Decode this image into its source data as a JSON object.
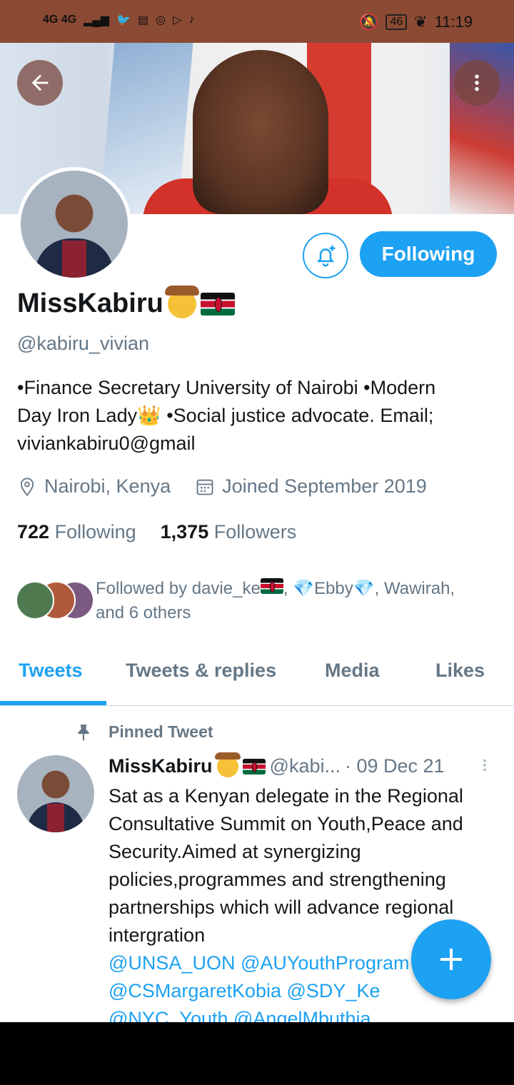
{
  "status_bar": {
    "network_left": "4G 4G",
    "battery": "46",
    "time": "11:19"
  },
  "profile": {
    "name": "MissKabiru",
    "handle": "@kabiru_vivian",
    "bio_line1": "•Finance Secretary University of Nairobi •Modern",
    "bio_line2a": "Day Iron Lady",
    "bio_line2b": " •Social justice advocate. Email;",
    "bio_line3": "viviankabiru0@gmail",
    "location": "Nairobi, Kenya",
    "joined": "Joined September 2019",
    "following_count": "722",
    "following_label": "Following",
    "followers_count": "1,375",
    "followers_label": "Followers",
    "followed_by_a": "Followed by davie_ke",
    "followed_by_b": ", 💎Ebby💎, Wawirah,",
    "followed_by_c": "and 6 others",
    "follow_button": "Following"
  },
  "tabs": [
    "Tweets",
    "Tweets & replies",
    "Media",
    "Likes"
  ],
  "pinned_tweet": {
    "label": "Pinned Tweet",
    "author": "MissKabiru",
    "handle": "@kabi...",
    "date": "· 09 Dec 21",
    "text": "Sat as a Kenyan delegate in the Regional Consultative Summit on Youth,Peace and Security.Aimed at synergizing policies,programmes and strengthening partnerships which will advance regional intergration",
    "mentions_line1": "@UNSA_UON @AUYouthProgram",
    "mentions_line2": "@CSMargaretKobia @SDY_Ke",
    "mentions_line3": "@NYC_Youth @AngelMbuthia"
  },
  "colors": {
    "accent": "#1da1f2",
    "status_bar": "#8b4a33"
  },
  "icons": {
    "back": "arrow-left-icon",
    "more": "more-vertical-icon",
    "bell": "bell-plus-icon",
    "location": "location-pin-icon",
    "calendar": "calendar-icon",
    "pin": "pin-icon",
    "compose": "plus-icon"
  }
}
